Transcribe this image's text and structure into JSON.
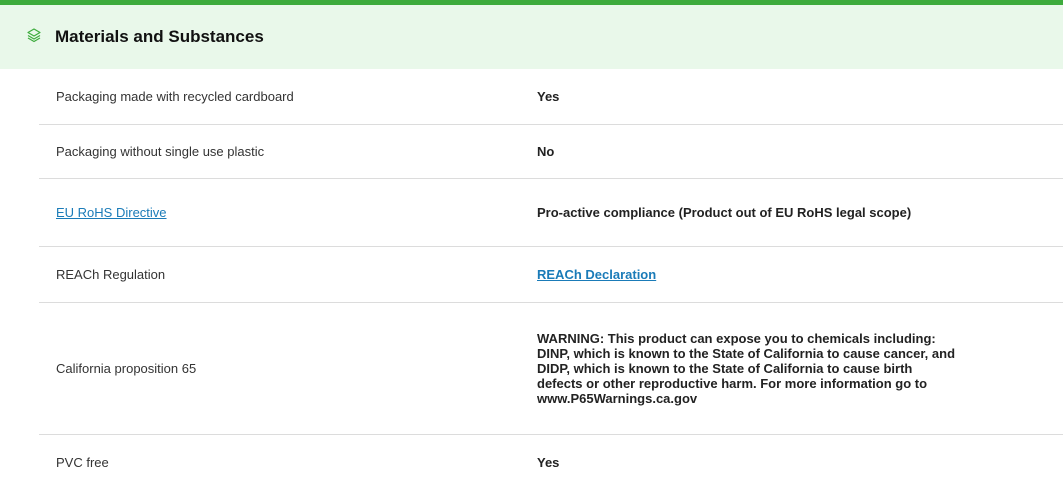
{
  "colors": {
    "accent": "#3dab3d",
    "header_bg": "#e9f8ea",
    "link": "#1a7bb8",
    "divider": "#dcdcdc"
  },
  "section": {
    "icon": "layers-icon",
    "title": "Materials and Substances"
  },
  "rows": [
    {
      "label": "Packaging made with recycled cardboard",
      "value": "Yes"
    },
    {
      "label": "Packaging without single use plastic",
      "value": "No"
    },
    {
      "label": "EU RoHS Directive",
      "value": "Pro-active compliance (Product out of EU RoHS legal scope)"
    },
    {
      "label": "REACh Regulation",
      "value": "REACh Declaration"
    },
    {
      "label": "California proposition 65",
      "value": "WARNING: This product can expose you to chemicals including: DINP, which is known to the State of California to cause cancer, and DIDP, which is known to the State of California to cause birth defects or other reproductive harm. For more information go to www.P65Warnings.ca.gov"
    },
    {
      "label": "PVC free",
      "value": "Yes"
    }
  ]
}
